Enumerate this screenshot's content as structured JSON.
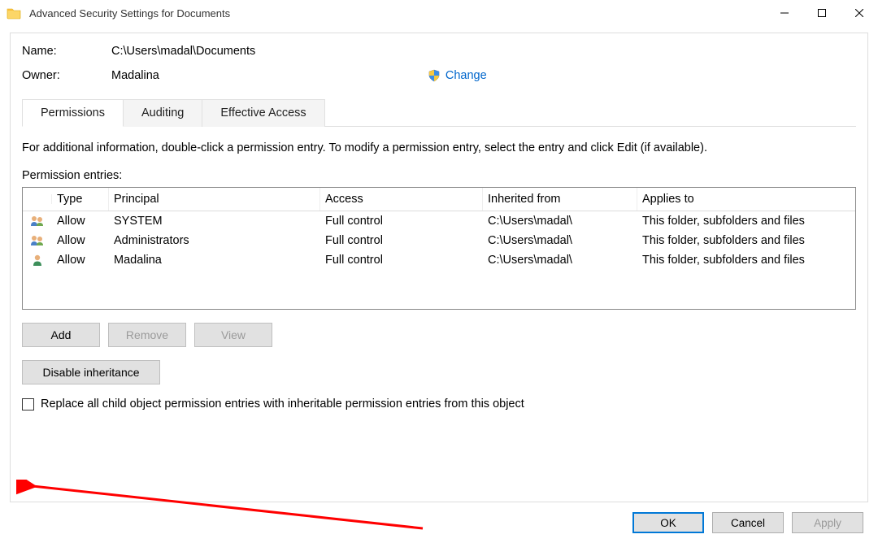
{
  "titlebar": {
    "title": "Advanced Security Settings for Documents"
  },
  "header": {
    "name_label": "Name:",
    "name_value": "C:\\Users\\madal\\Documents",
    "owner_label": "Owner:",
    "owner_value": "Madalina",
    "change": "Change"
  },
  "tabs": {
    "permissions": "Permissions",
    "auditing": "Auditing",
    "effective": "Effective Access"
  },
  "instructions": "For additional information, double-click a permission entry. To modify a permission entry, select the entry and click Edit (if available).",
  "entries_label": "Permission entries:",
  "columns": {
    "type": "Type",
    "principal": "Principal",
    "access": "Access",
    "inherited": "Inherited from",
    "applies": "Applies to"
  },
  "rows": [
    {
      "icon": "group",
      "type": "Allow",
      "principal": "SYSTEM",
      "access": "Full control",
      "inherited": "C:\\Users\\madal\\",
      "applies": "This folder, subfolders and files"
    },
    {
      "icon": "group",
      "type": "Allow",
      "principal": "Administrators",
      "access": "Full control",
      "inherited": "C:\\Users\\madal\\",
      "applies": "This folder, subfolders and files"
    },
    {
      "icon": "user",
      "type": "Allow",
      "principal": "Madalina",
      "access": "Full control",
      "inherited": "C:\\Users\\madal\\",
      "applies": "This folder, subfolders and files"
    }
  ],
  "buttons": {
    "add": "Add",
    "remove": "Remove",
    "view": "View",
    "disable_inh": "Disable inheritance"
  },
  "checkbox": {
    "label": "Replace all child object permission entries with inheritable permission entries from this object"
  },
  "footer": {
    "ok": "OK",
    "cancel": "Cancel",
    "apply": "Apply"
  }
}
